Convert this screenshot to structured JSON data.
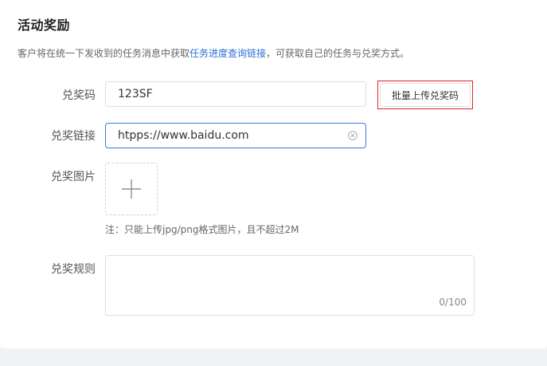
{
  "section": {
    "title": "活动奖励",
    "desc_before": "客户将在统一下发收到的任务消息中获取",
    "desc_link": "任务进度查询链接",
    "desc_after": "，可获取自己的任务与兑奖方式。"
  },
  "form": {
    "code": {
      "label": "兑奖码",
      "value": "123SF"
    },
    "batch_upload_button": "批量上传兑奖码",
    "link": {
      "label": "兑奖链接",
      "value": "htpps://www.baidu.com"
    },
    "image": {
      "label": "兑奖图片",
      "hint": "注：只能上传jpg/png格式图片，且不超过2M"
    },
    "rules": {
      "label": "兑奖规则",
      "counter": "0/100"
    }
  },
  "colors": {
    "link": "#2d6fd6",
    "focus_border": "#3a7be0",
    "highlight_outline": "#e02424",
    "page_bg": "#f0f2f5"
  },
  "icons": {
    "clear": "circle-x-icon",
    "upload": "plus-icon"
  }
}
